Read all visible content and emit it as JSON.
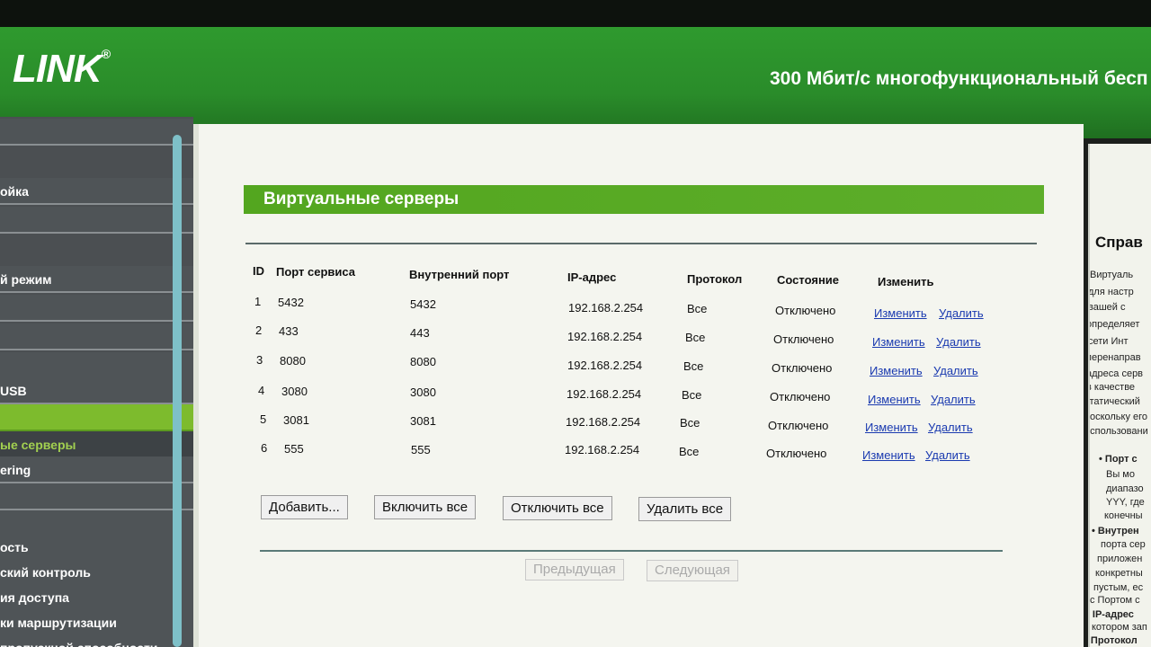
{
  "header": {
    "logo": "LINK",
    "title": "300 Мбит/с многофункциональный бесп"
  },
  "sidebar": {
    "items": [
      {
        "label": ""
      },
      {
        "label": "ойка"
      },
      {
        "label": ""
      },
      {
        "label": "й режим"
      },
      {
        "label": ""
      },
      {
        "label": ""
      },
      {
        "label": ""
      },
      {
        "label": "USB"
      },
      {
        "label": ""
      },
      {
        "label": "ые серверы"
      },
      {
        "label": "ering"
      },
      {
        "label": ""
      },
      {
        "label": ""
      },
      {
        "label": "ость"
      },
      {
        "label": "ский контроль"
      },
      {
        "label": "ия доступа"
      },
      {
        "label": "ки маршрутизации"
      },
      {
        "label": "пропускной способности"
      }
    ]
  },
  "main": {
    "section_title": "Виртуальные серверы",
    "columns": [
      "ID",
      "Порт сервиса",
      "Внутренний порт",
      "IP-адрес",
      "Протокол",
      "Состояние",
      "Изменить"
    ],
    "rows": [
      {
        "id": "1",
        "service_port": "5432",
        "internal_port": "5432",
        "ip": "192.168.2.254",
        "protocol": "Все",
        "status": "Отключено",
        "edit": "Изменить",
        "delete": "Удалить"
      },
      {
        "id": "2",
        "service_port": "433",
        "internal_port": "443",
        "ip": "192.168.2.254",
        "protocol": "Все",
        "status": "Отключено",
        "edit": "Изменить",
        "delete": "Удалить"
      },
      {
        "id": "3",
        "service_port": "8080",
        "internal_port": "8080",
        "ip": "192.168.2.254",
        "protocol": "Все",
        "status": "Отключено",
        "edit": "Изменить",
        "delete": "Удалить"
      },
      {
        "id": "4",
        "service_port": "3080",
        "internal_port": "3080",
        "ip": "192.168.2.254",
        "protocol": "Все",
        "status": "Отключено",
        "edit": "Изменить",
        "delete": "Удалить"
      },
      {
        "id": "5",
        "service_port": "3081",
        "internal_port": "3081",
        "ip": "192.168.2.254",
        "protocol": "Все",
        "status": "Отключено",
        "edit": "Изменить",
        "delete": "Удалить"
      },
      {
        "id": "6",
        "service_port": "555",
        "internal_port": "555",
        "ip": "192.168.2.254",
        "protocol": "Все",
        "status": "Отключено",
        "edit": "Изменить",
        "delete": "Удалить"
      }
    ],
    "buttons": {
      "add": "Добавить...",
      "enable_all": "Включить все",
      "disable_all": "Отключить все",
      "delete_all": "Удалить все",
      "prev": "Предыдущая",
      "next": "Следующая"
    }
  },
  "help": {
    "title": "Справ",
    "lines": [
      "Виртуаль",
      "для настр",
      "вашей с",
      "определяет",
      "сети Инт",
      "перенаправ",
      "адреса серв",
      "в качестве",
      "статический",
      "поскольку его",
      "использовани",
      "• Порт с",
      "Вы мо",
      "диапазо",
      "YYY, где",
      "конечны",
      "• Внутрен",
      "порта сер",
      "приложен",
      "конкретны",
      "пустым, ес",
      "с Портом с",
      "• IP-адрес",
      "котором зап",
      "• Протокол"
    ]
  }
}
